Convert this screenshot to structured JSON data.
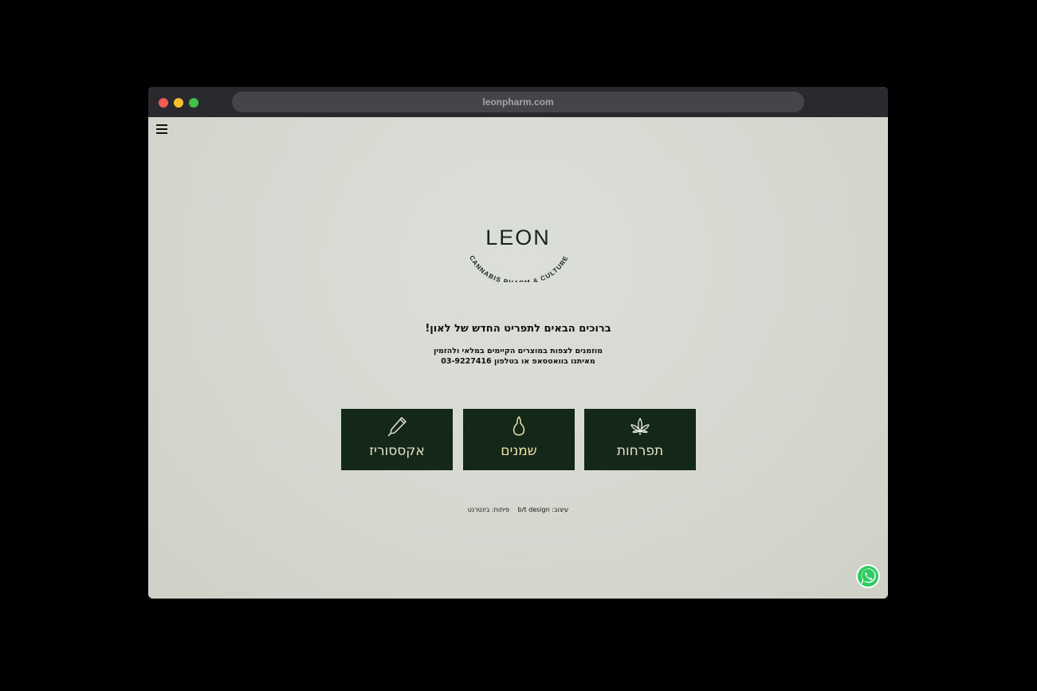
{
  "browser": {
    "url": "leonpharm.com"
  },
  "logo": {
    "word": "LEON",
    "tagline": "CANNABIS PHARM & CULTURE"
  },
  "welcome": {
    "title": "ברוכים הבאים לתפריט החדש של לאון!",
    "line1": "מוזמנים לצפות במוצרים הקיימים במלאי ולהזמין",
    "line2": "מאיתנו בוואטסאפ או בטלפון 03-9227416"
  },
  "tiles": [
    {
      "label": "אקססוריז",
      "icon": "pen-icon"
    },
    {
      "label": "שמנים",
      "icon": "oil-drop-icon"
    },
    {
      "label": "תפרחות",
      "icon": "cannabis-leaf-icon"
    }
  ],
  "footer": {
    "design": "עיצוב: b/t design",
    "dev": "פיתוח: בינטרנט"
  },
  "colors": {
    "tile_bg": "#132818",
    "page_bg": "#d6d8d0",
    "whatsapp": "#2ecc60"
  }
}
